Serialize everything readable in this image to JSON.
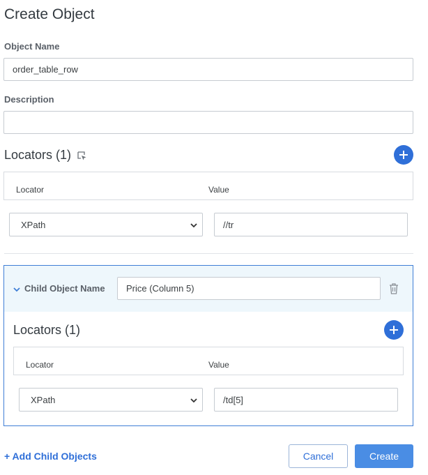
{
  "page": {
    "title": "Create Object"
  },
  "form": {
    "object_name_label": "Object Name",
    "object_name_value": "order_table_row",
    "description_label": "Description",
    "description_value": ""
  },
  "locators": {
    "title": "Locators (1)",
    "col_locator": "Locator",
    "col_value": "Value",
    "rows": [
      {
        "locator": "XPath",
        "value": "//tr"
      }
    ]
  },
  "child": {
    "name_label": "Child Object Name",
    "name_value": "Price (Column 5)",
    "locators_title": "Locators (1)",
    "col_locator": "Locator",
    "col_value": "Value",
    "rows": [
      {
        "locator": "XPath",
        "value": "/td[5]"
      }
    ]
  },
  "footer": {
    "add_child_label": "+ Add Child Objects",
    "cancel_label": "Cancel",
    "create_label": "Create"
  },
  "colors": {
    "accent": "#2f6fd8",
    "child_border": "#3f7ed6",
    "child_header_bg": "#eef7fc"
  }
}
